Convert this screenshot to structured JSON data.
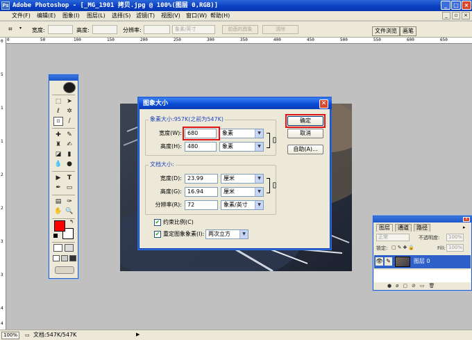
{
  "window": {
    "title": "Adobe Photoshop - [_MG_1901 拷贝.jpg @ 100%(图层 0,RGB)]",
    "logo": "Ps"
  },
  "menu": {
    "items": [
      "文件(F)",
      "编辑(E)",
      "图象(I)",
      "图层(L)",
      "选择(S)",
      "滤镜(T)",
      "视图(V)",
      "窗口(W)",
      "帮助(H)"
    ]
  },
  "options": {
    "width_label": "宽度:",
    "height_label": "高度:",
    "resolution_label": "分辨率:",
    "unit_value": "象素/英寸",
    "front_image_button": "前面的图象",
    "clear_button": "清除",
    "file_browser_tab": "文件浏览",
    "brushes_tab": "画笔"
  },
  "ruler": {
    "top": [
      "0",
      "50",
      "100",
      "150",
      "200",
      "250",
      "300",
      "350",
      "400",
      "450",
      "500",
      "550",
      "600",
      "650"
    ],
    "left": [
      "0",
      "5",
      "1",
      "1",
      "2",
      "2",
      "3",
      "3",
      "4",
      "4"
    ]
  },
  "toolbox": {
    "foreground_color": "#ff0000",
    "background_color": "#ffffff"
  },
  "dialog": {
    "title": "图象大小",
    "pixel_dimensions_label": "象素大小:957K(之前为547K)",
    "width_label": "宽度(W):",
    "width_value": "680",
    "width_unit": "象素",
    "height_label": "高度(H):",
    "height_value": "480",
    "height_unit": "象素",
    "document_size_label": "文档大小:",
    "doc_width_label": "宽度(D):",
    "doc_width_value": "23.99",
    "doc_width_unit": "厘米",
    "doc_height_label": "高度(G):",
    "doc_height_value": "16.94",
    "doc_height_unit": "厘米",
    "resolution_label": "分辨率(R):",
    "resolution_value": "72",
    "resolution_unit": "象素/英寸",
    "constrain_label": "约束比例(C)",
    "resample_label": "重定图象象素(I):",
    "resample_method": "两次立方",
    "ok_button": "确定",
    "cancel_button": "取消",
    "auto_button": "自助(A)...",
    "highlight_color": "#e01414"
  },
  "layers": {
    "tabs": [
      "图层",
      "通道",
      "路径"
    ],
    "blend_mode": "正常",
    "opacity_label": "不透明度:",
    "opacity_value": "100%",
    "lock_label": "锁定:",
    "fill_label": "Fill:",
    "fill_value": "100%",
    "layer_name": "图层 0"
  },
  "status": {
    "zoom": "100%",
    "doc_info": "文档:547K/547K"
  }
}
